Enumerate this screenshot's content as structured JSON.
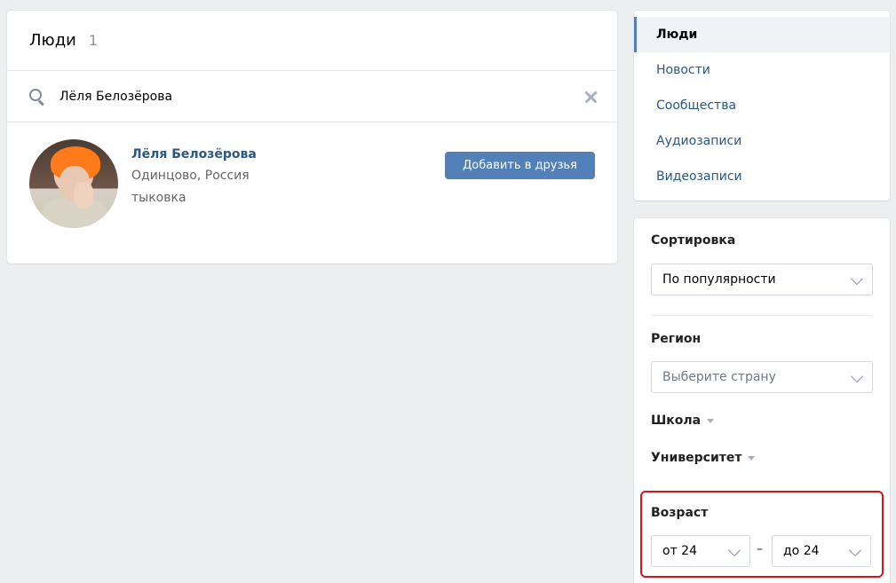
{
  "results": {
    "title": "Люди",
    "count": "1",
    "search_value": "Лёля Белозёрова",
    "person": {
      "name": "Лёля Белозёрова",
      "city": "Одинцово, Россия",
      "status": "тыковка",
      "add_button": "Добавить в друзья"
    }
  },
  "nav": {
    "items": [
      {
        "label": "Люди",
        "active": true
      },
      {
        "label": "Новости"
      },
      {
        "label": "Сообщества"
      },
      {
        "label": "Аудиозаписи"
      },
      {
        "label": "Видеозаписи"
      }
    ]
  },
  "filters": {
    "sort_label": "Сортировка",
    "sort_value": "По популярности",
    "region_label": "Регион",
    "country_placeholder": "Выберите страну",
    "school_label": "Школа",
    "university_label": "Университет",
    "age_label": "Возраст",
    "age_from": "от 24",
    "age_separator": "–",
    "age_to": "до 24"
  },
  "colors": {
    "accent": "#5181b8",
    "link": "#2a5885",
    "highlight_border": "#d4151d",
    "background": "#edeef0"
  }
}
